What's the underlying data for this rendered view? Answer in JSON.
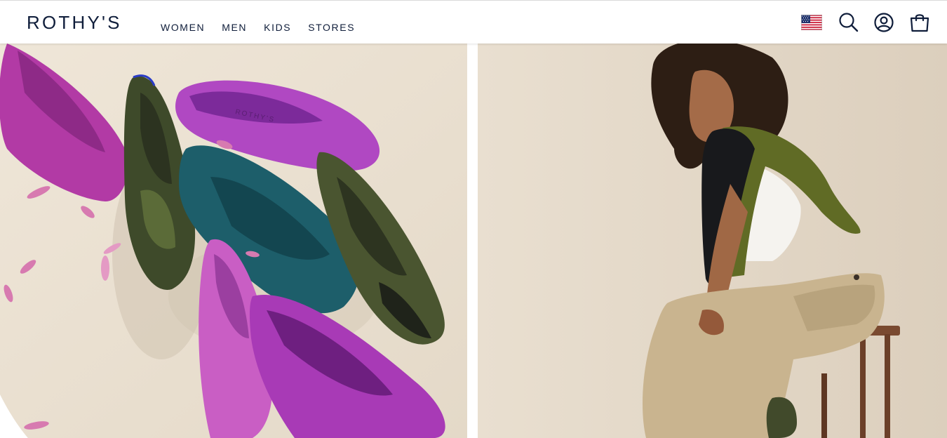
{
  "brand": {
    "logo_text": "ROTHY'S"
  },
  "nav": {
    "items": [
      {
        "label": "WOMEN"
      },
      {
        "label": "MEN"
      },
      {
        "label": "KIDS"
      },
      {
        "label": "STORES"
      }
    ]
  },
  "header_icons": [
    "us-flag-icon",
    "search-icon",
    "account-icon",
    "bag-icon"
  ],
  "hero": {
    "left_image": "flats-assortment-photo",
    "right_image": "model-seated-photo",
    "shoe_insole_text": "ROTHY'S"
  },
  "colors": {
    "brand_navy": "#0f1d3a",
    "header_bg": "#ffffff"
  }
}
